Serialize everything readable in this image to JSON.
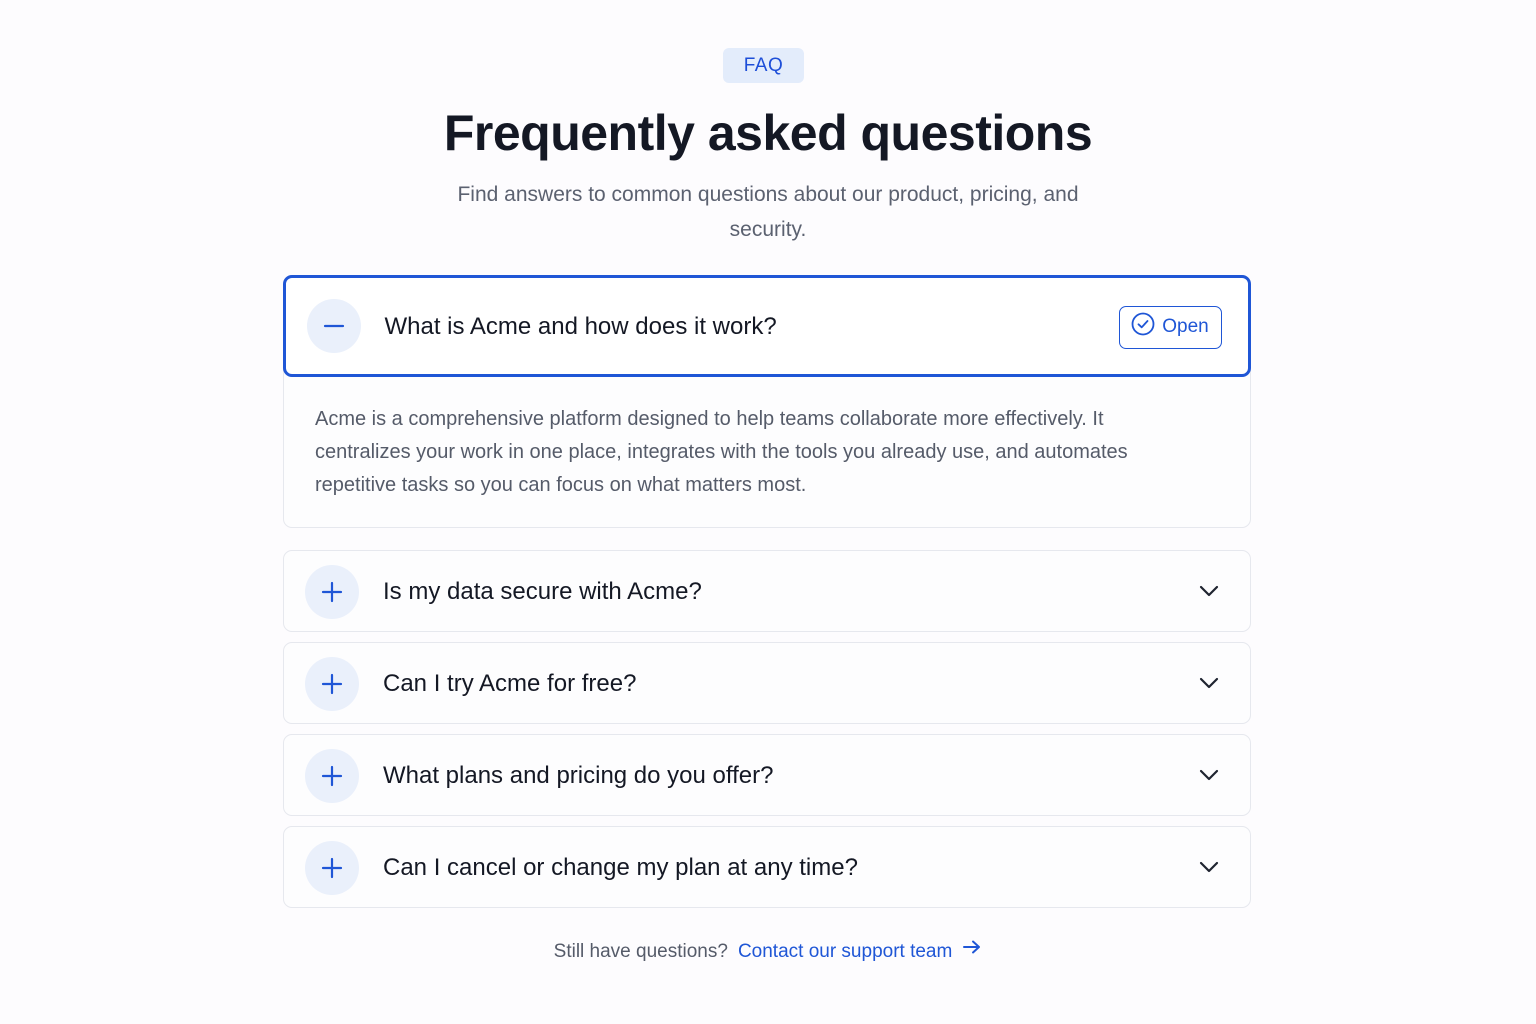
{
  "badge": "FAQ",
  "title": "Frequently asked questions",
  "subtitle": "Find answers to common questions about our product, pricing, and security.",
  "faq": {
    "open_item": {
      "question": "What is Acme and how does it work?",
      "status_label": "Open",
      "answer": "Acme is a comprehensive platform designed to help teams collaborate more effectively. It centralizes your work in one place, integrates with the tools you already use, and automates repetitive tasks so you can focus on what matters most."
    },
    "items": [
      {
        "question": "Is my data secure with Acme?"
      },
      {
        "question": "Can I try Acme for free?"
      },
      {
        "question": "What plans and pricing do you offer?"
      },
      {
        "question": "Can I cancel or change my plan at any time?"
      }
    ]
  },
  "footer": {
    "prompt": "Still have questions?",
    "link_label": "Contact our support team"
  },
  "colors": {
    "accent": "#1f56d6",
    "badge_bg": "#e3ecfb",
    "icon_circle_bg": "#eaf0fb",
    "heading": "#141824",
    "muted_text": "#555b69"
  },
  "icons": {
    "collapse": "minus-icon",
    "expand": "plus-icon",
    "open_status": "check-circle-icon",
    "chevron": "chevron-down-icon",
    "link_arrow": "arrow-right-icon"
  }
}
